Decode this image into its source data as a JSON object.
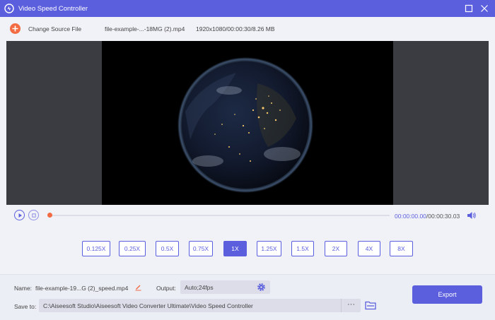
{
  "window": {
    "title": "Video Speed Controller"
  },
  "source": {
    "change_label": "Change Source File",
    "file_name": "file-example-...-18MG (2).mp4",
    "file_info": "1920x1080/00:00:30/8.26 MB"
  },
  "player": {
    "current_time": "00:00:00.00",
    "separator": "/",
    "total_time": "00:00:30.03",
    "progress": 0.0
  },
  "speeds": {
    "options": [
      "0.125X",
      "0.25X",
      "0.5X",
      "0.75X",
      "1X",
      "1.25X",
      "1.5X",
      "2X",
      "4X",
      "8X"
    ],
    "selected": "1X"
  },
  "output": {
    "name_label": "Name:",
    "name_value": "file-example-19...G (2)_speed.mp4",
    "output_label": "Output:",
    "output_value": "Auto;24fps",
    "save_label": "Save to:",
    "save_path": "C:\\Aiseesoft Studio\\Aiseesoft Video Converter Ultimate\\Video Speed Controller",
    "browse_label": "···",
    "export_label": "Export"
  },
  "colors": {
    "accent": "#5b5fde",
    "orange": "#f26b43"
  }
}
